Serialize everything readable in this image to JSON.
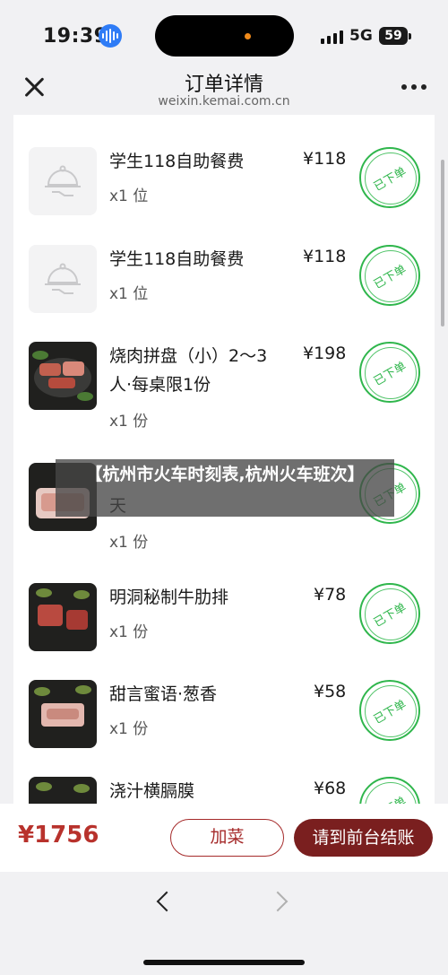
{
  "status_bar": {
    "time": "19:39",
    "network": "5G",
    "battery": "59"
  },
  "header": {
    "title": "订单详情",
    "url": "weixin.kemai.com.cn"
  },
  "items": [
    {
      "name_line1": "学生118自助餐费",
      "name_line2": "",
      "qty": "x1 位",
      "price": "¥118",
      "status": "已下单",
      "image": "placeholder"
    },
    {
      "name_line1": "学生118自助餐费",
      "name_line2": "",
      "qty": "x1 位",
      "price": "¥118",
      "status": "已下单",
      "image": "placeholder"
    },
    {
      "name_line1": "烧肉拼盘（小）2～3",
      "name_line2": "人·每桌限1份",
      "qty": "x1 份",
      "price": "¥198",
      "status": "已下单",
      "image": "photo"
    },
    {
      "name_line1": "",
      "name_line2": "天",
      "qty": "x1 份",
      "price": "",
      "status": "已下单",
      "image": "photo"
    },
    {
      "name_line1": "明洞秘制牛肋排",
      "name_line2": "",
      "qty": "x1 份",
      "price": "¥78",
      "status": "已下单",
      "image": "photo"
    },
    {
      "name_line1": "甜言蜜语·葱香",
      "name_line2": "",
      "qty": "x1 份",
      "price": "¥58",
      "status": "已下单",
      "image": "photo"
    },
    {
      "name_line1": "浇汁横膈膜",
      "name_line2": "",
      "qty": "",
      "price": "¥68",
      "status": "已下单",
      "image": "photo"
    }
  ],
  "overlay": {
    "text": "【杭州市火车时刻表,杭州火车班次】"
  },
  "footer": {
    "total": "¥1756",
    "add_label": "加菜",
    "pay_label": "请到前台结账"
  },
  "colors": {
    "accent": "#7a1f1f",
    "stamp": "#2fb64c",
    "total": "#b8322c"
  },
  "icons": {
    "close": "close-icon",
    "more": "more-icon",
    "back": "back-icon",
    "forward": "forward-icon",
    "placeholder": "food-cloche-icon"
  }
}
